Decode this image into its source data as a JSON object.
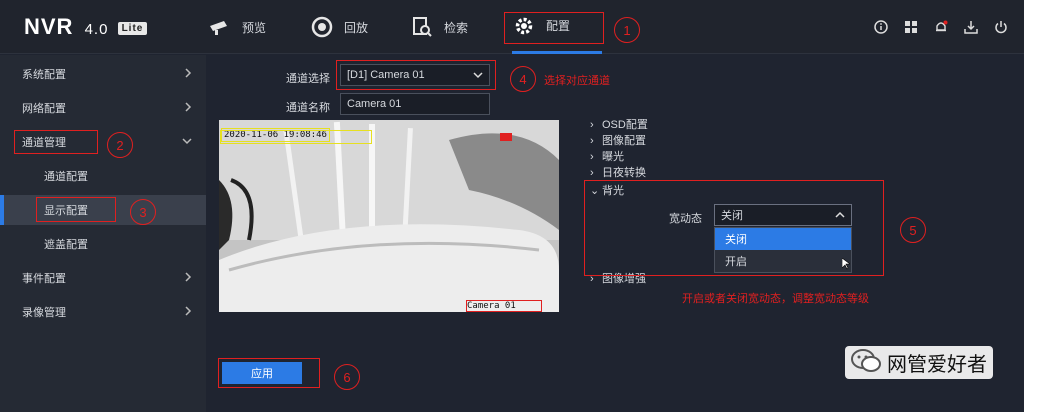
{
  "brand": {
    "name": "NVR",
    "version": "4.0",
    "edition": "Lite"
  },
  "nav": {
    "tabs": [
      {
        "label": "预览",
        "icon": "camera-icon"
      },
      {
        "label": "回放",
        "icon": "playback-icon"
      },
      {
        "label": "检索",
        "icon": "search-file-icon"
      },
      {
        "label": "配置",
        "icon": "gear-icon",
        "active": true
      }
    ],
    "right_icons": [
      "info-icon",
      "apps-icon",
      "bell-icon",
      "download-icon",
      "power-icon"
    ]
  },
  "sidebar": {
    "items": [
      {
        "label": "系统配置"
      },
      {
        "label": "网络配置"
      },
      {
        "label": "通道管理",
        "expanded": true
      },
      {
        "label": "通道配置"
      },
      {
        "label": "显示配置",
        "active": true
      },
      {
        "label": "遮盖配置"
      },
      {
        "label": "事件配置"
      },
      {
        "label": "录像管理"
      }
    ]
  },
  "form": {
    "channel_select_label": "通道选择",
    "channel_select_value": "[D1] Camera 01",
    "channel_name_label": "通道名称",
    "channel_name_value": "Camera 01"
  },
  "preview": {
    "osd_time": "2020-11-06 19:08:46",
    "osd_name": "Camera 01"
  },
  "params": {
    "sections": [
      "OSD配置",
      "图像配置",
      "曝光",
      "日夜转换",
      "背光",
      "图像增强"
    ],
    "wdr_label": "宽动态",
    "wdr_value": "关闭",
    "wdr_options": [
      "关闭",
      "开启"
    ]
  },
  "actions": {
    "apply_label": "应用"
  },
  "annotations": {
    "markers": [
      "1",
      "2",
      "3",
      "4",
      "5",
      "6"
    ],
    "note_select_channel": "选择对应通道",
    "note_wdr": "开启或者关闭宽动态，调整宽动态等级"
  },
  "watermark": {
    "text": "网管爱好者"
  },
  "colors": {
    "accent": "#2c7be5",
    "annotation": "#e02020",
    "background": "#1f2430"
  }
}
